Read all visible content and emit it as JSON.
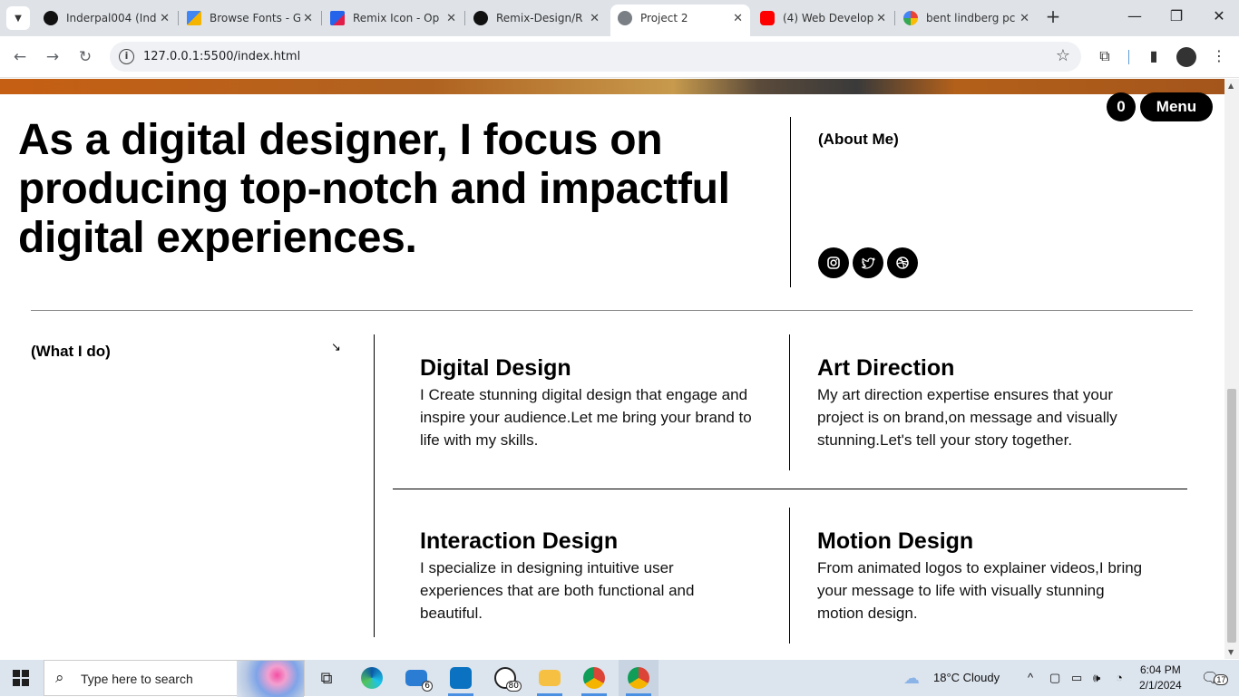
{
  "browser": {
    "tabs": [
      {
        "title": "Inderpal004 (Ind",
        "favicon": "github-icon",
        "color": "#111111"
      },
      {
        "title": "Browse Fonts - G",
        "favicon": "google-fonts-icon",
        "color": "#f4b400"
      },
      {
        "title": "Remix Icon - Op",
        "favicon": "remix-icon",
        "color": "#2563eb"
      },
      {
        "title": "Remix-Design/R",
        "favicon": "github-icon",
        "color": "#111111"
      },
      {
        "title": "Project 2",
        "favicon": "globe-icon",
        "color": "#5f6368"
      },
      {
        "title": "(4) Web Develop",
        "favicon": "youtube-icon",
        "color": "#ff0000"
      },
      {
        "title": "bent lindberg pc",
        "favicon": "google-icon",
        "color": "#4285f4"
      }
    ],
    "active_tab_index": 4,
    "url": "127.0.0.1:5500/index.html"
  },
  "page": {
    "cart_count": "0",
    "menu_label": "Menu",
    "headline": "As a digital designer, I focus on producing top-notch and impactful digital experiences.",
    "about_label": "(About Me)",
    "socials": [
      "instagram-icon",
      "twitter-icon",
      "dribbble-icon"
    ],
    "what_i_do_label": "(What I do)",
    "arrow_glyph": "↘",
    "services": [
      {
        "title": "Digital Design",
        "text": "I Create stunning digital design that engage and inspire your audience.Let me bring your brand to life with my skills."
      },
      {
        "title": "Art Direction",
        "text": "My art direction expertise ensures that your project is on brand,on message and visually stunning.Let's tell your story together."
      },
      {
        "title": "Interaction Design",
        "text": "I specialize in designing intuitive user experiences that are both functional and beautiful."
      },
      {
        "title": "Motion Design",
        "text": "From animated logos to explainer videos,I bring your message to life with visually stunning motion design."
      }
    ]
  },
  "taskbar": {
    "search_placeholder": "Type here to search",
    "mail_badge": "6",
    "whatsapp_badge": "80",
    "weather": "18°C  Cloudy",
    "time": "6:04 PM",
    "date": "2/1/2024",
    "notifications": "17"
  }
}
